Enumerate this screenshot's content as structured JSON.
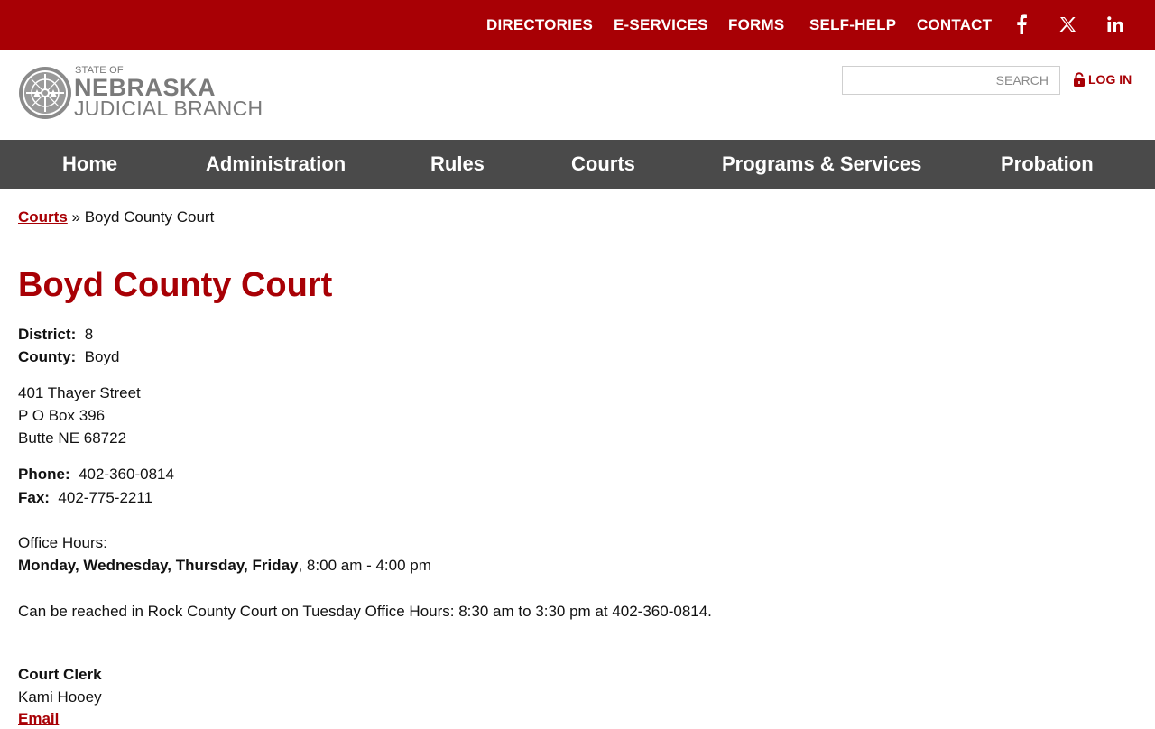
{
  "topbar": {
    "links": [
      "DIRECTORIES",
      "E-SERVICES",
      "FORMS",
      "SELF-HELP",
      "CONTACT"
    ],
    "social_icons": [
      "facebook-icon",
      "x-twitter-icon",
      "linkedin-icon"
    ],
    "bg_color": "#a80005"
  },
  "logo": {
    "line1": "STATE OF",
    "line2": "NEBRASKA",
    "line3": "JUDICIAL BRANCH"
  },
  "search": {
    "placeholder": "SEARCH",
    "value": ""
  },
  "login": {
    "label": "LOG IN",
    "icon": "lock-icon"
  },
  "nav": {
    "items": [
      "Home",
      "Administration",
      "Rules",
      "Courts",
      "Programs & Services",
      "Probation"
    ],
    "bg_color": "#4a4a4a"
  },
  "breadcrumb": {
    "parent": "Courts",
    "separator": " » ",
    "current": "Boyd County Court"
  },
  "page": {
    "title": "Boyd County Court",
    "district_label": "District:",
    "district_value": "8",
    "county_label": "County:",
    "county_value": "Boyd",
    "address": [
      "401 Thayer Street",
      "P O Box 396",
      "Butte NE 68722"
    ],
    "phone_label": "Phone:",
    "phone_value": "402-360-0814",
    "fax_label": "Fax:",
    "fax_value": "402-775-2211",
    "hours_label": "Office Hours:",
    "hours_days": "Monday, Wednesday, Thursday, Friday",
    "hours_time": ", 8:00 am - 4:00 pm",
    "note": "Can be reached in Rock County Court on Tuesday Office Hours: 8:30 am to 3:30 pm at 402-360-0814.",
    "clerk_label": "Court Clerk",
    "clerk_name": "Kami Hooey",
    "email_label": "Email",
    "accent_color": "#a80005"
  }
}
